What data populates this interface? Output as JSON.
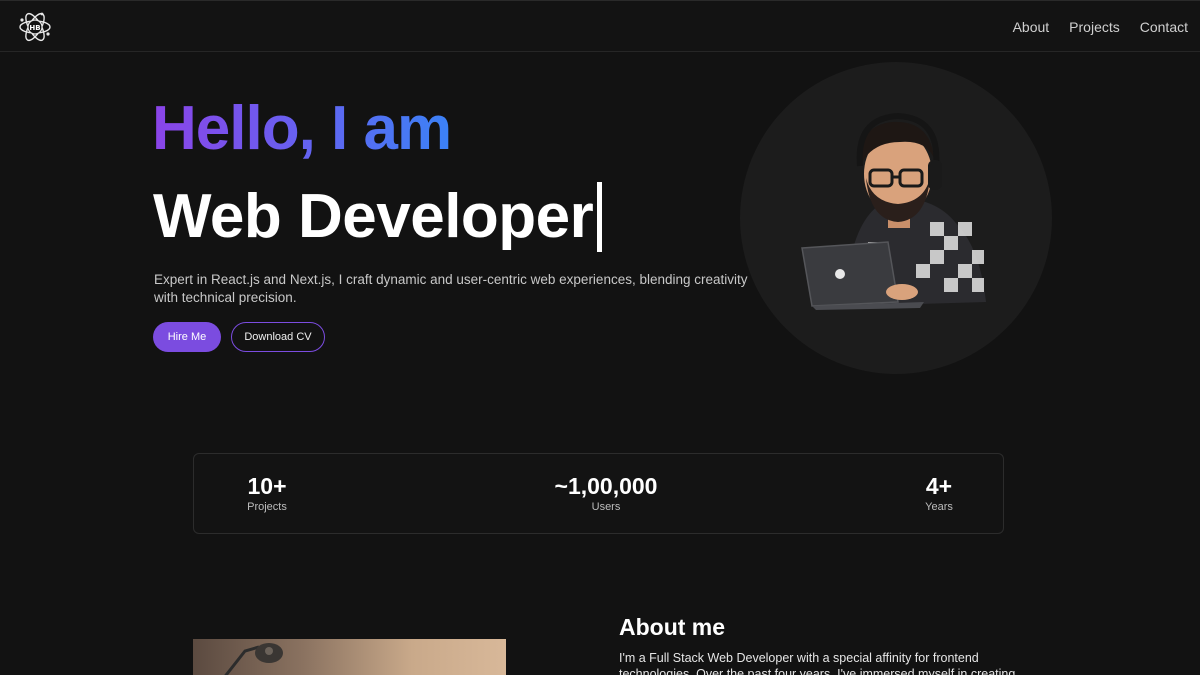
{
  "nav": {
    "links": [
      "About",
      "Projects",
      "Contact"
    ]
  },
  "hero": {
    "greeting": "Hello, I am",
    "role": "Web Developer",
    "description": "Expert in React.js and Next.js, I craft dynamic and user-centric web experiences, blending creativity with technical precision.",
    "hire_label": "Hire Me",
    "cv_label": "Download CV"
  },
  "stats": [
    {
      "value": "10+",
      "label": "Projects"
    },
    {
      "value": "~1,00,000",
      "label": "Users"
    },
    {
      "value": "4+",
      "label": "Years"
    }
  ],
  "about": {
    "title": "About me",
    "text": "I'm a Full Stack Web Developer with a special affinity for frontend technologies. Over the past four years, I've immersed myself in creating"
  },
  "colors": {
    "accent": "#7b4ce0",
    "gradient_start": "#8b44e8",
    "gradient_end": "#3b82f6",
    "background": "#121212"
  },
  "icons": {
    "logo": "atom-logo-icon",
    "avatar": "developer-avatar-illustration"
  }
}
